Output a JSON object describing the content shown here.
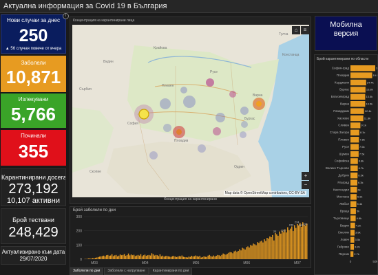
{
  "header": {
    "title": "Актуална информация за Covid 19 в България"
  },
  "stats": {
    "new_cases": {
      "label": "Нови случаи за днес",
      "value": "250",
      "sub": "▲ 56 случая повече от вчера"
    },
    "infected": {
      "label": "Заболели",
      "value": "10,871"
    },
    "recovered": {
      "label": "Излекувани",
      "value": "5,766"
    },
    "deaths": {
      "label": "Починали",
      "value": "355"
    },
    "quarantined": {
      "label": "Карантинирани досега",
      "value": "273,192",
      "active": "10,107 активни"
    },
    "tested": {
      "label": "Брой тествани",
      "value": "248,429"
    },
    "updated": {
      "label": "Актуализирано към дата",
      "value": "29/07/2020"
    }
  },
  "map": {
    "header": "Концентрация на карантинирани лица",
    "footer": "Концентрация на карантинирани",
    "attribution": "Map data © OpenStreetMap contributors, CC-BY-SA",
    "places": [
      "Крайова",
      "Видин",
      "Русе",
      "Варна",
      "Бургас",
      "Плевен",
      "София",
      "Пловдив",
      "Скопие",
      "Одрин",
      "Сърбия",
      "Констанца",
      "Тулча"
    ]
  },
  "mobile": {
    "label_line1": "Мобилна",
    "label_line2": "версия"
  },
  "chart": {
    "title": "Брой заболели по дни"
  },
  "tabs": [
    "Заболели по дни",
    "Заболели с натрупване",
    "Карантинирани по дни"
  ],
  "side": {
    "title": "Брой карантинирани по области"
  },
  "colors": {
    "new_cases": "#0a1d5e",
    "infected": "#e79b21",
    "recovered": "#3aa428",
    "deaths": "#e0101a",
    "bar": "#e79b21"
  },
  "chart_data": [
    {
      "type": "bar",
      "title": "Брой заболели по дни",
      "ylim": [
        0,
        300
      ],
      "yticks": [
        0,
        100,
        200,
        300
      ],
      "xticks": [
        "М03",
        "М04",
        "М05",
        "М06",
        "М07"
      ],
      "values": [
        1,
        2,
        3,
        5,
        6,
        4,
        8,
        7,
        10,
        12,
        15,
        18,
        20,
        22,
        25,
        19,
        28,
        30,
        24,
        26,
        35,
        22,
        27,
        30,
        20,
        25,
        33,
        28,
        30,
        36,
        24,
        29,
        40,
        27,
        33,
        28,
        31,
        22,
        26,
        30,
        25,
        35,
        20,
        28,
        32,
        24,
        28,
        30,
        26,
        42,
        35,
        26,
        30,
        28,
        22,
        34,
        20,
        25,
        18,
        22,
        24,
        20,
        18,
        16,
        21,
        23,
        19,
        15,
        18,
        22,
        20,
        26,
        17,
        15,
        14,
        12,
        18,
        16,
        24,
        19,
        21,
        26,
        22,
        18,
        24,
        12,
        15,
        20,
        17,
        16,
        25,
        30,
        22,
        18,
        26,
        19,
        24,
        30,
        28,
        22,
        30,
        40,
        35,
        32,
        38,
        45,
        50,
        48,
        42,
        55,
        60,
        52,
        58,
        70,
        62,
        80,
        75,
        68,
        85,
        90,
        82,
        100,
        95,
        110,
        105,
        98,
        120,
        115,
        125,
        130,
        118,
        140,
        128,
        150,
        145,
        160,
        155,
        170,
        132,
        185,
        175,
        165,
        195,
        180,
        200,
        190,
        210,
        188,
        225,
        205,
        215,
        230,
        198,
        240,
        220,
        248,
        238,
        255,
        228,
        260,
        242,
        235,
        250
      ],
      "labels": [
        "23",
        "153",
        "240",
        "274",
        "287",
        "330"
      ]
    },
    {
      "type": "bar",
      "title": "Брой карантинирани по области",
      "categories": [
        "София-град",
        "Пловдив",
        "Кърджали",
        "Бургас",
        "Благоевград",
        "Варна",
        "Пазарджик",
        "Хасково",
        "Сливен",
        "Стара Загора",
        "Плевен",
        "Русе",
        "Шумен",
        "Софийска",
        "Велико Търново",
        "Добрич",
        "Разград",
        "Кюстендил",
        "Монтана",
        "Ямбол",
        "Враца",
        "Търговище",
        "Видин",
        "Смолян",
        "Ловеч",
        "Габрово",
        "Перник"
      ],
      "values": [
        30500,
        19900,
        14400,
        13800,
        13500,
        13500,
        12400,
        11800,
        9100,
        8100,
        7800,
        7600,
        7500,
        6800,
        6700,
        6500,
        6300,
        6000,
        5600,
        5400,
        5000,
        4800,
        4200,
        3800,
        3500,
        3200,
        2700
      ],
      "labels": [
        "30.5k",
        "19.9k",
        "14.4k",
        "13.8k",
        "13.5k",
        "13.5k",
        "12.4k",
        "11.8k",
        "9.1k",
        "8.1k",
        "7.8k",
        "7.6k",
        "7.5k",
        "6.8k",
        "6.7k",
        "6.5k",
        "6.3k",
        "6k",
        "5.6k",
        "5.4k",
        "5k",
        "4.8k",
        "4.2k",
        "3.8k",
        "3.5k",
        "3.2k",
        "2.7k"
      ],
      "xlim": [
        0,
        50000
      ],
      "xticks": [
        "0",
        "50k"
      ]
    }
  ]
}
